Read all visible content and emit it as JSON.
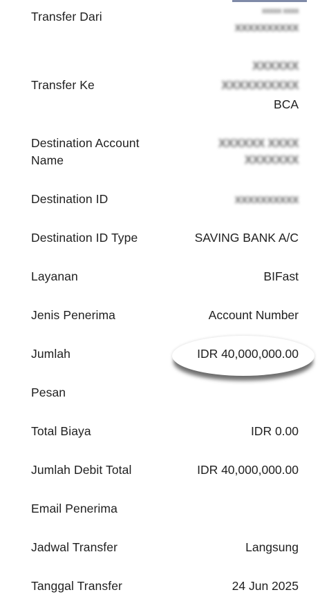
{
  "header": {
    "sender_name_small": "xxxxx xxxx"
  },
  "rows": [
    {
      "label": "Transfer Dari",
      "value_lines": [
        "xxxxxxxxxx"
      ]
    },
    {
      "label": "Transfer Ke",
      "value_lines": [
        "XXXXXX",
        "XXXXXXXXXX",
        "BCA"
      ]
    },
    {
      "label": "Destination Account Name",
      "value_lines": [
        "XXXXXX XXXX",
        "XXXXXXX"
      ]
    },
    {
      "label": "Destination ID",
      "value": "xxxxxxxxxx"
    },
    {
      "label": "Destination ID Type",
      "value": "SAVING BANK A/C"
    },
    {
      "label": "Layanan",
      "value": "BIFast"
    },
    {
      "label": "Jenis Penerima",
      "value": "Account Number"
    },
    {
      "label": "Jumlah",
      "value": "IDR 40,000,000.00"
    },
    {
      "label": "Pesan",
      "value": ""
    },
    {
      "label": "Total Biaya",
      "value": "IDR 0.00"
    },
    {
      "label": "Jumlah Debit Total",
      "value": "IDR 40,000,000.00"
    },
    {
      "label": "Email Penerima",
      "value": ""
    },
    {
      "label": "Jadwal Transfer",
      "value": "Langsung"
    },
    {
      "label": "Tanggal Transfer",
      "value": "24 Jun 2025"
    }
  ]
}
